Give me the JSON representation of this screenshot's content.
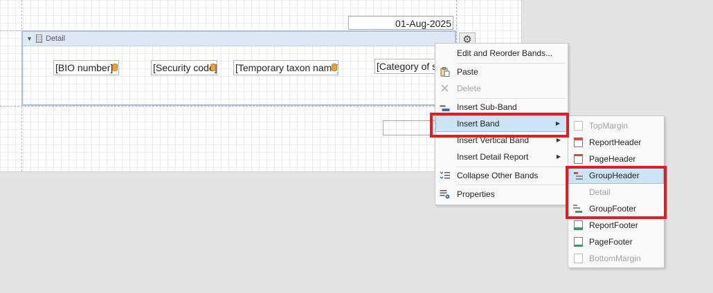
{
  "report": {
    "date_value": "01-Aug-2025",
    "detail_band_label": "Detail",
    "fields": [
      {
        "label": "[BIO number]"
      },
      {
        "label": "[Security code]"
      },
      {
        "label": "[Temporary taxon name]"
      },
      {
        "label": "[Category of s"
      }
    ]
  },
  "context_menu": {
    "items": [
      {
        "label": "Edit and Reorder Bands...",
        "enabled": true
      },
      {
        "label": "Paste",
        "enabled": true,
        "icon": "paste-icon"
      },
      {
        "label": "Delete",
        "enabled": false,
        "icon": "delete-icon"
      },
      {
        "label": "Insert Sub-Band",
        "enabled": true,
        "icon": "insert-subband-icon"
      },
      {
        "label": "Insert Band",
        "enabled": true,
        "has_submenu": true,
        "highlighted": true
      },
      {
        "label": "Insert Vertical Band",
        "enabled": true,
        "has_submenu": true
      },
      {
        "label": "Insert Detail Report",
        "enabled": true,
        "has_submenu": true
      },
      {
        "label": "Collapse Other Bands",
        "enabled": true,
        "icon": "collapse-bands-icon"
      },
      {
        "label": "Properties",
        "enabled": true,
        "icon": "properties-icon"
      }
    ]
  },
  "band_submenu": {
    "items": [
      {
        "label": "TopMargin",
        "enabled": false
      },
      {
        "label": "ReportHeader",
        "enabled": true
      },
      {
        "label": "PageHeader",
        "enabled": true
      },
      {
        "label": "GroupHeader",
        "enabled": true,
        "highlighted": true
      },
      {
        "label": "Detail",
        "enabled": false
      },
      {
        "label": "GroupFooter",
        "enabled": true
      },
      {
        "label": "ReportFooter",
        "enabled": true
      },
      {
        "label": "PageFooter",
        "enabled": true
      },
      {
        "label": "BottomMargin",
        "enabled": false
      }
    ]
  },
  "colors": {
    "highlight_border": "#e31b23",
    "menu_highlight": "#cde3f6",
    "band_header": "#dfe9f6"
  }
}
